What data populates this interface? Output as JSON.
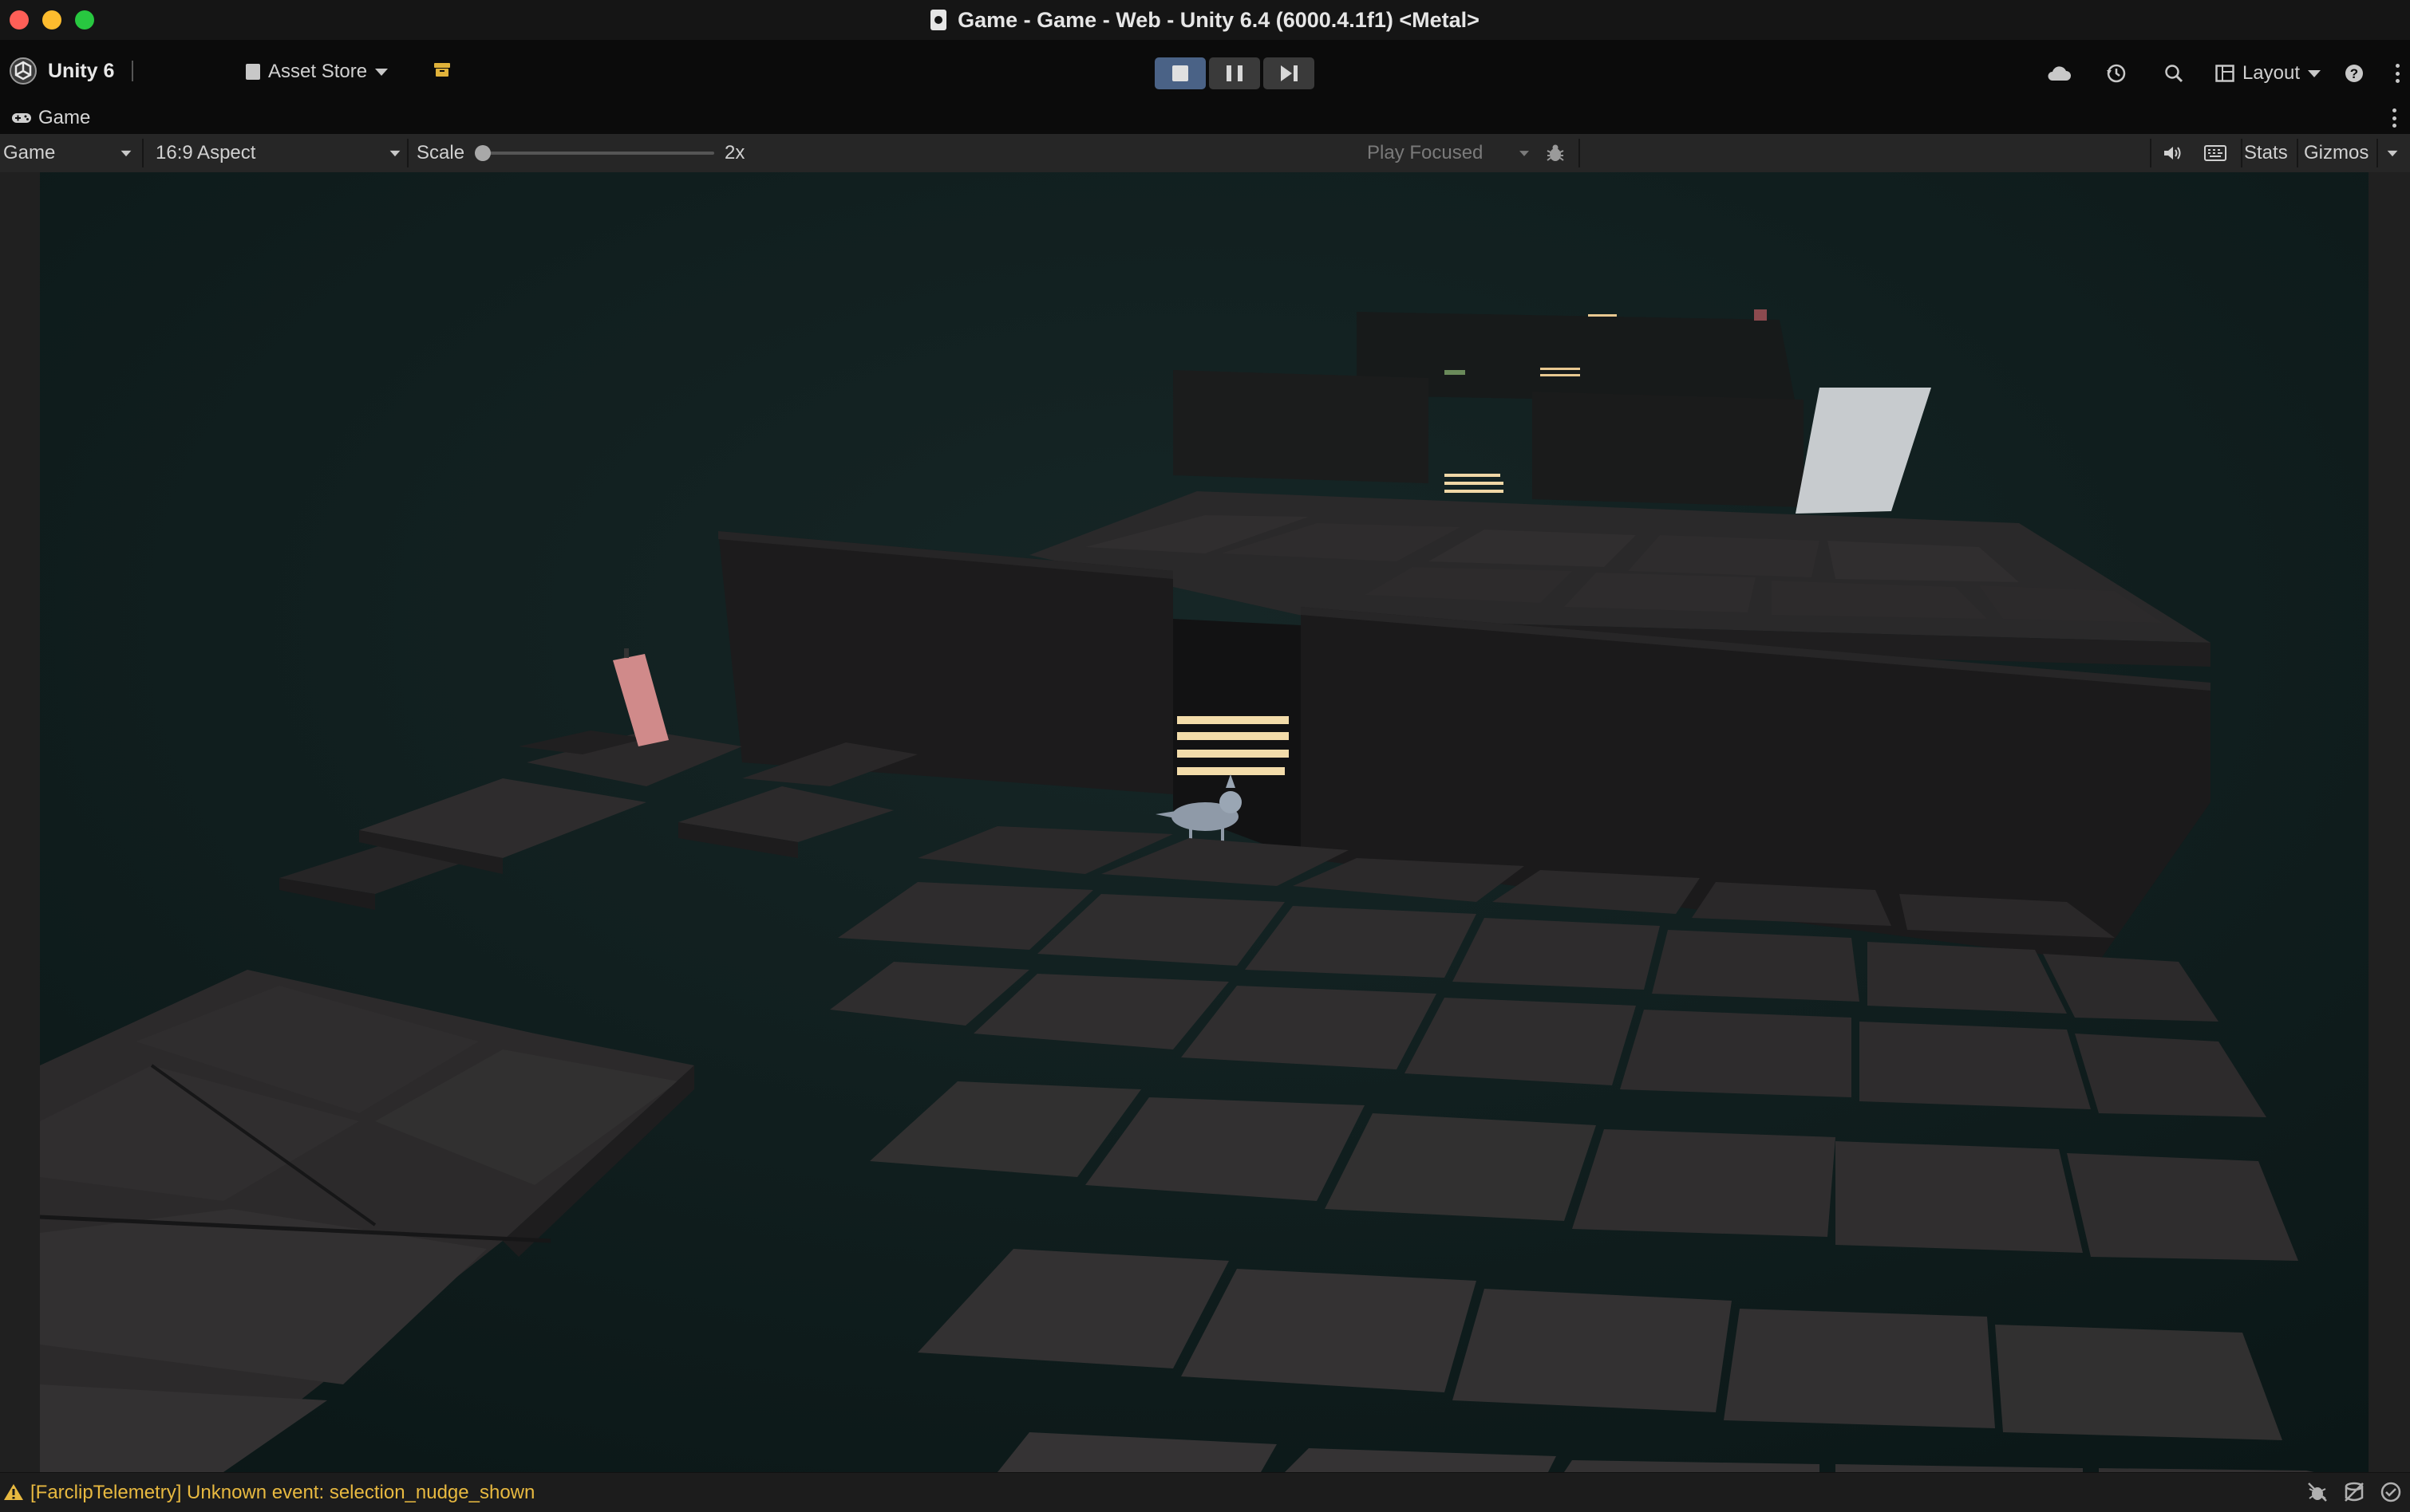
{
  "window": {
    "title": "Game - Game - Web - Unity 6.4 (6000.4.1f1) <Metal>",
    "traffic_colors": [
      "#ff5f57",
      "#febc2e",
      "#28c840"
    ]
  },
  "toolbar": {
    "account_label": "Unity 6",
    "asset_store_label": "Asset Store",
    "layout_label": "Layout",
    "playing": true,
    "icons": [
      "unity-logo-icon",
      "bag-icon",
      "package-manager-icon",
      "stop-icon",
      "pause-icon",
      "step-icon",
      "cloud-icon",
      "history-icon",
      "search-icon",
      "layout-icon",
      "help-icon",
      "more-vert-icon"
    ]
  },
  "tab": {
    "label": "Game",
    "icon": "gamepad-icon"
  },
  "game_toolbar": {
    "display_label": "Game",
    "aspect_label": "16:9 Aspect",
    "scale_label": "Scale",
    "scale_value": "2x",
    "play_mode_label": "Play Focused",
    "stats_label": "Stats",
    "gizmos_label": "Gizmos",
    "icons": [
      "bug-icon",
      "audio-icon",
      "keyboard-icon"
    ]
  },
  "viewport": {
    "background": "#0f1c1c",
    "scene": "3D dark tiled platforms with walls, glowing striped vents, a small grey creature and a pink card"
  },
  "status": {
    "message": "[FarclipTelemetry] Unknown event: selection_nudge_shown",
    "accent": "#e8b940"
  }
}
